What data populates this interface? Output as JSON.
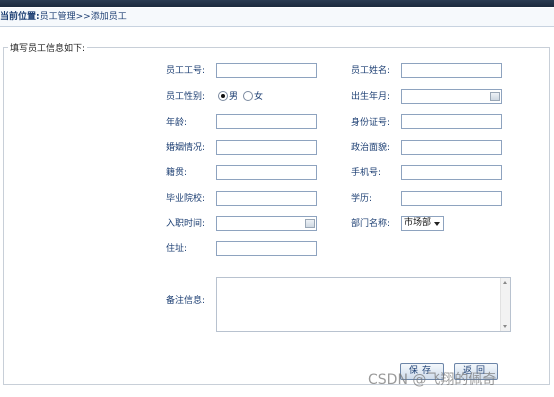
{
  "breadcrumb": {
    "current_label": "当前位置:",
    "path": "员工管理>>添加员工"
  },
  "form": {
    "legend": "填写员工信息如下:",
    "fields": {
      "emp_no": {
        "label": "员工工号:"
      },
      "emp_name": {
        "label": "员工姓名:"
      },
      "gender": {
        "label": "员工性别:",
        "options": [
          "男",
          "女"
        ],
        "selected": "男"
      },
      "birth": {
        "label": "出生年月:"
      },
      "age": {
        "label": "年龄:"
      },
      "id_card": {
        "label": "身份证号:"
      },
      "marital": {
        "label": "婚姻情况:"
      },
      "politics": {
        "label": "政治面貌:"
      },
      "native": {
        "label": "籍贯:"
      },
      "phone": {
        "label": "手机号:"
      },
      "school": {
        "label": "毕业院校:"
      },
      "education": {
        "label": "学历:"
      },
      "hire_date": {
        "label": "入职时间:"
      },
      "department": {
        "label": "部门名称:",
        "value": "市场部"
      },
      "address": {
        "label": "住址:"
      },
      "remark": {
        "label": "备注信息:"
      }
    },
    "buttons": {
      "save": "保存",
      "back": "返回"
    }
  },
  "watermark": "CSDN @飞翔的佩奇",
  "icons": [
    "calendar-icon",
    "dropdown-arrow-icon",
    "scroll-up-icon",
    "scroll-down-icon"
  ]
}
